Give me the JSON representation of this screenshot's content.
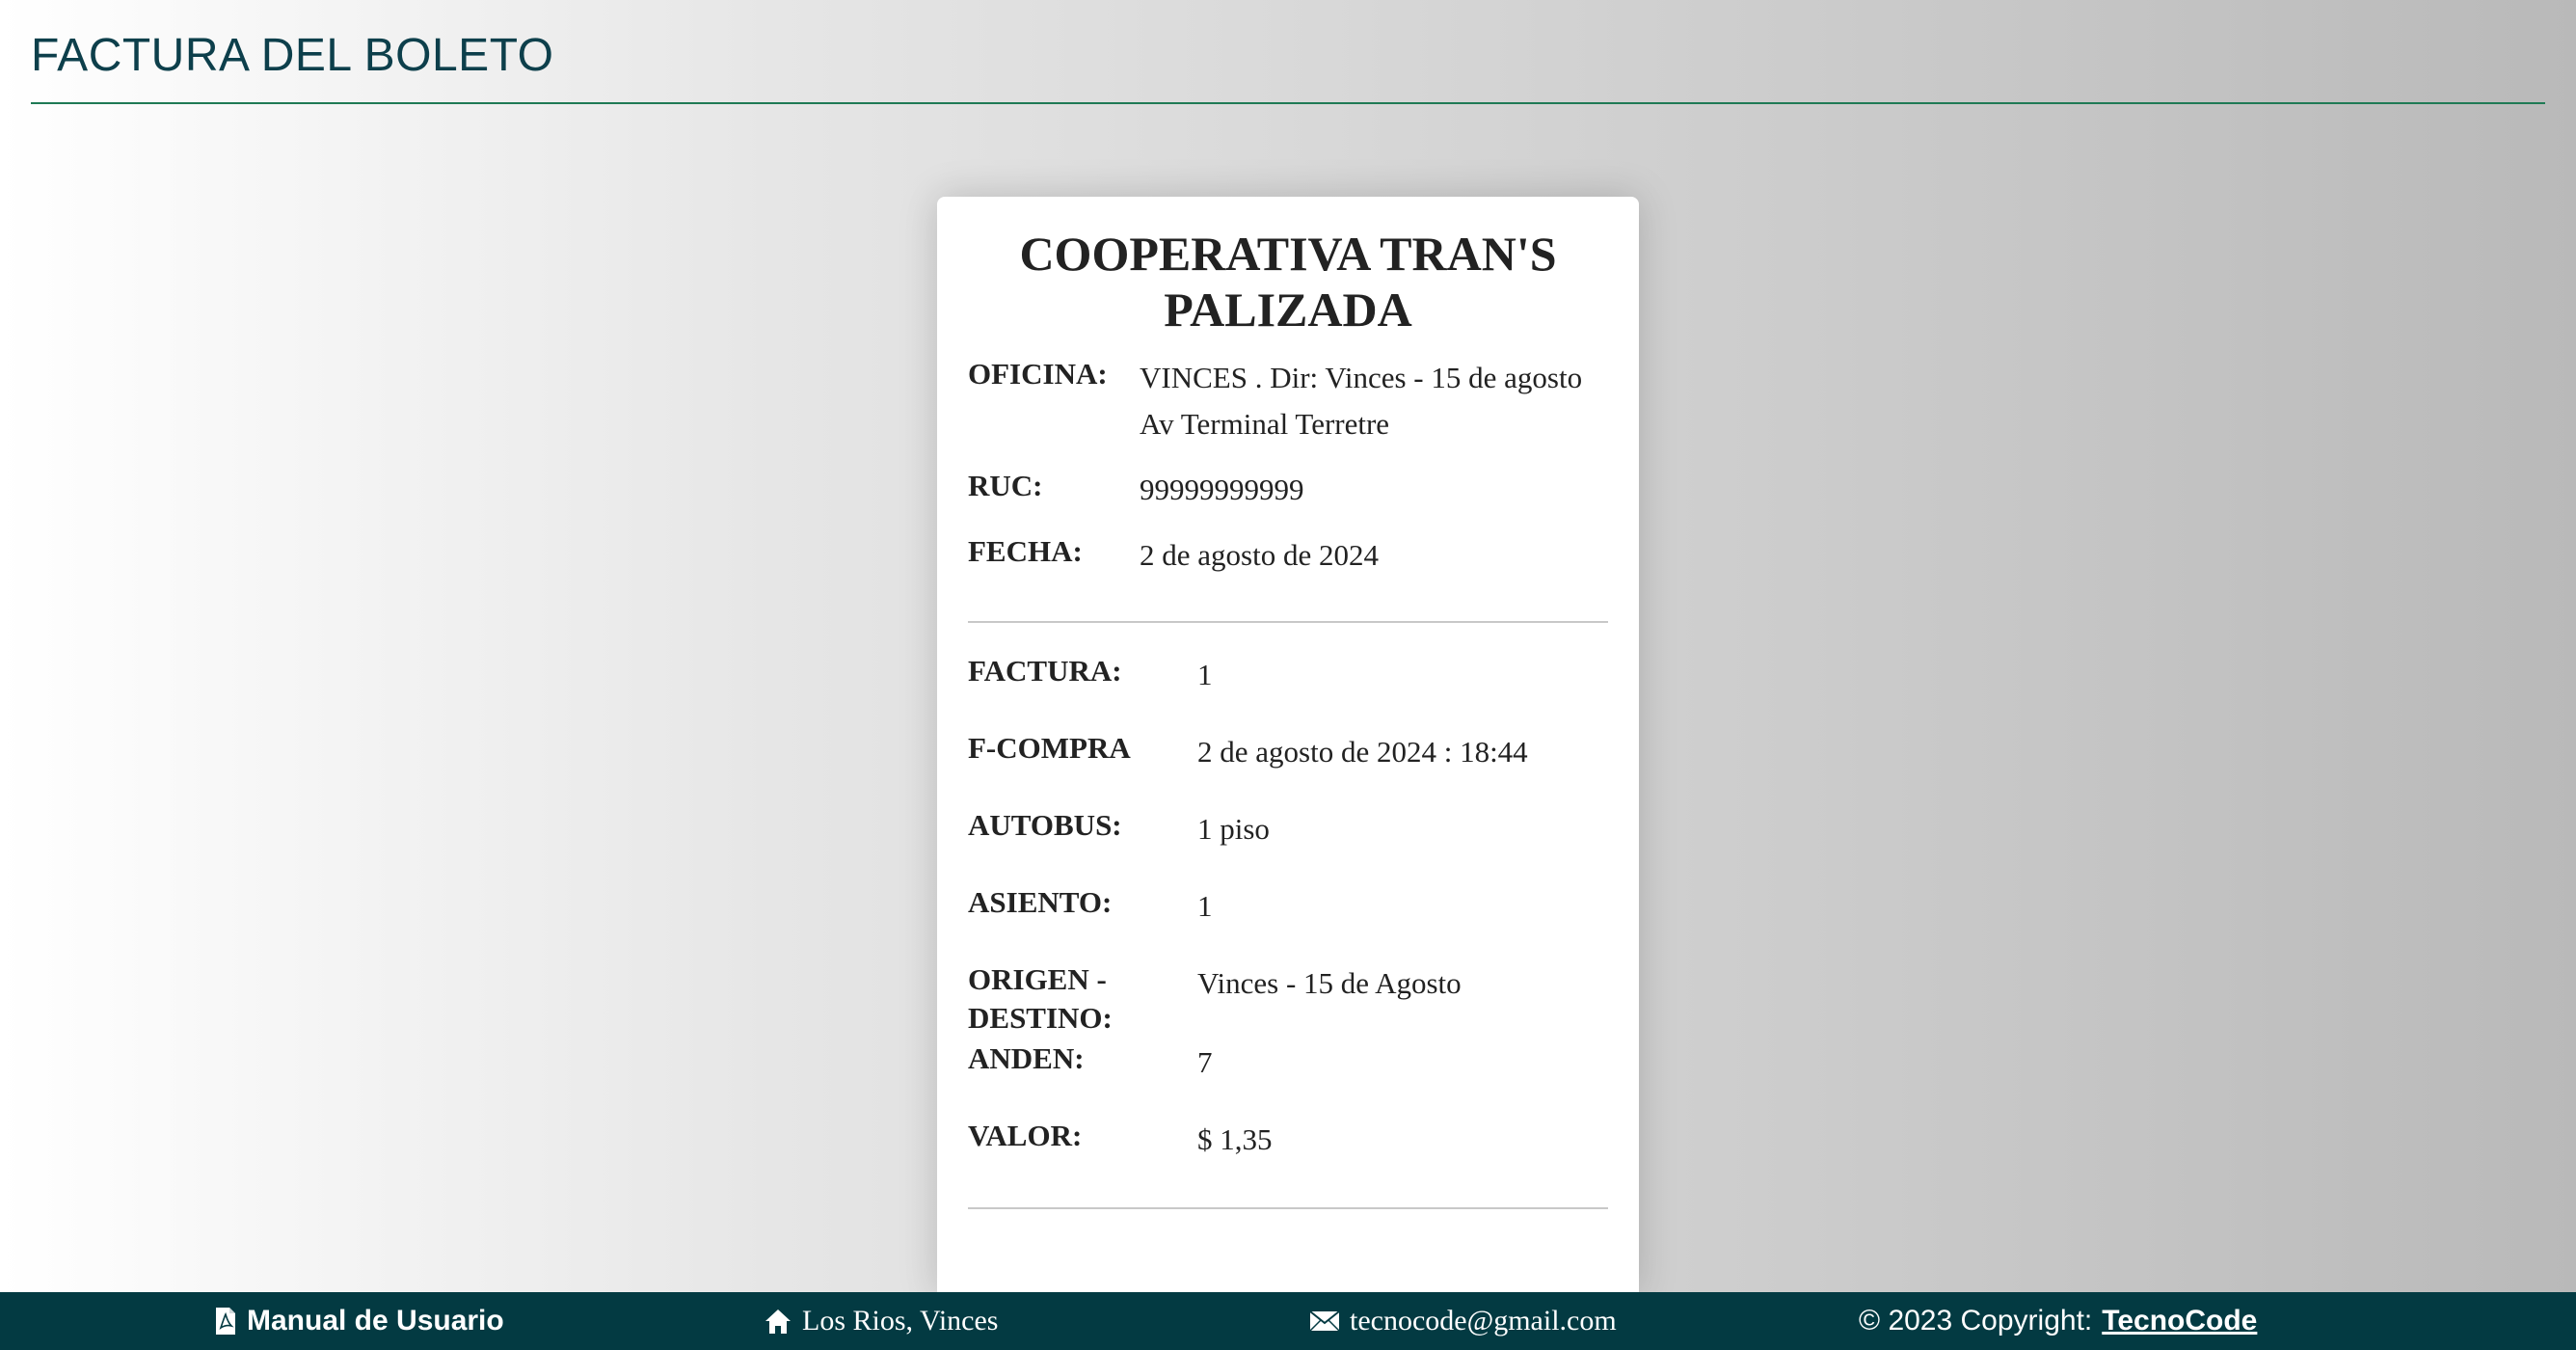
{
  "page": {
    "title": "FACTURA DEL BOLETO"
  },
  "receipt": {
    "company": "COOPERATIVA TRAN'S PALIZADA",
    "office_label": "OFICINA:",
    "office_value_line1": "VINCES . Dir: Vinces - 15 de agosto",
    "office_value_line2": "Av Terminal Terretre",
    "ruc_label": "RUC:",
    "ruc_value": "99999999999",
    "date_label": "FECHA:",
    "date_value": "2 de agosto de 2024",
    "invoice_label": "FACTURA:",
    "invoice_value": "1",
    "purchase_label": "F-COMPRA",
    "purchase_value": "2 de agosto de 2024 : 18:44",
    "bus_label": "AUTOBUS:",
    "bus_value": "1 piso",
    "seat_label": "ASIENTO:",
    "seat_value": "1",
    "route_label_line1": "ORIGEN -",
    "route_label_line2": "DESTINO:",
    "route_value": "Vinces - 15 de Agosto",
    "platform_label": "ANDEN:",
    "platform_value": "7",
    "price_label": "VALOR:",
    "price_value": "$ 1,35"
  },
  "footer": {
    "manual_label": "Manual de Usuario",
    "manual_icon": "pdf-file-icon",
    "location_label": "Los Rios, Vinces",
    "location_icon": "home-icon",
    "email_label": "tecnocode@gmail.com",
    "email_icon": "envelope-icon",
    "copyright_prefix": "© 2023 Copyright:",
    "copyright_link": "TecnoCode",
    "background_color": "#033a42"
  },
  "colors": {
    "title": "#0d3f4b",
    "header_rule": "#1f7a55"
  }
}
